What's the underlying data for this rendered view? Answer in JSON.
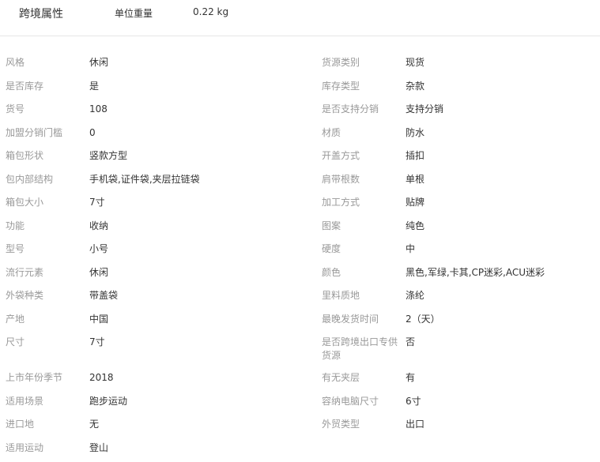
{
  "header": {
    "title": "跨境属性",
    "weight_label": "单位重量",
    "weight_value": "0.22 kg"
  },
  "attributes": [
    [
      {
        "label": "风格",
        "value": "休闲"
      },
      {
        "label": "货源类别",
        "value": "现货"
      }
    ],
    [
      {
        "label": "是否库存",
        "value": "是"
      },
      {
        "label": "库存类型",
        "value": "杂款"
      }
    ],
    [
      {
        "label": "货号",
        "value": "108"
      },
      {
        "label": "是否支持分销",
        "value": "支持分销"
      }
    ],
    [
      {
        "label": "加盟分销门槛",
        "value": "0"
      },
      {
        "label": "材质",
        "value": "防水"
      }
    ],
    [
      {
        "label": "箱包形状",
        "value": "竖款方型"
      },
      {
        "label": "开盖方式",
        "value": "插扣"
      }
    ],
    [
      {
        "label": "包内部结构",
        "value": "手机袋,证件袋,夹层拉链袋"
      },
      {
        "label": "肩带根数",
        "value": "单根"
      }
    ],
    [
      {
        "label": "箱包大小",
        "value": "7寸"
      },
      {
        "label": "加工方式",
        "value": "贴牌"
      }
    ],
    [
      {
        "label": "功能",
        "value": "收纳"
      },
      {
        "label": "图案",
        "value": "纯色"
      }
    ],
    [
      {
        "label": "型号",
        "value": "小号"
      },
      {
        "label": "硬度",
        "value": "中"
      }
    ],
    [
      {
        "label": "流行元素",
        "value": "休闲"
      },
      {
        "label": "颜色",
        "value": "黑色,军绿,卡其,CP迷彩,ACU迷彩"
      }
    ],
    [
      {
        "label": "外袋种类",
        "value": "带盖袋"
      },
      {
        "label": "里料质地",
        "value": "涤纶"
      }
    ],
    [
      {
        "label": "产地",
        "value": "中国"
      },
      {
        "label": "最晚发货时间",
        "value": "2（天）"
      }
    ],
    [
      {
        "label": "尺寸",
        "value": "7寸"
      },
      {
        "label": "是否跨境出口专供货源",
        "value": "否"
      }
    ],
    [
      {
        "label": "上市年份季节",
        "value": "2018"
      },
      {
        "label": "有无夹层",
        "value": "有"
      }
    ],
    [
      {
        "label": "适用场景",
        "value": "跑步运动"
      },
      {
        "label": "容纳电脑尺寸",
        "value": "6寸"
      }
    ],
    [
      {
        "label": "进口地",
        "value": "无"
      },
      {
        "label": "外贸类型",
        "value": "出口"
      }
    ],
    [
      {
        "label": "适用运动",
        "value": "登山"
      },
      {
        "label": "",
        "value": ""
      }
    ]
  ]
}
